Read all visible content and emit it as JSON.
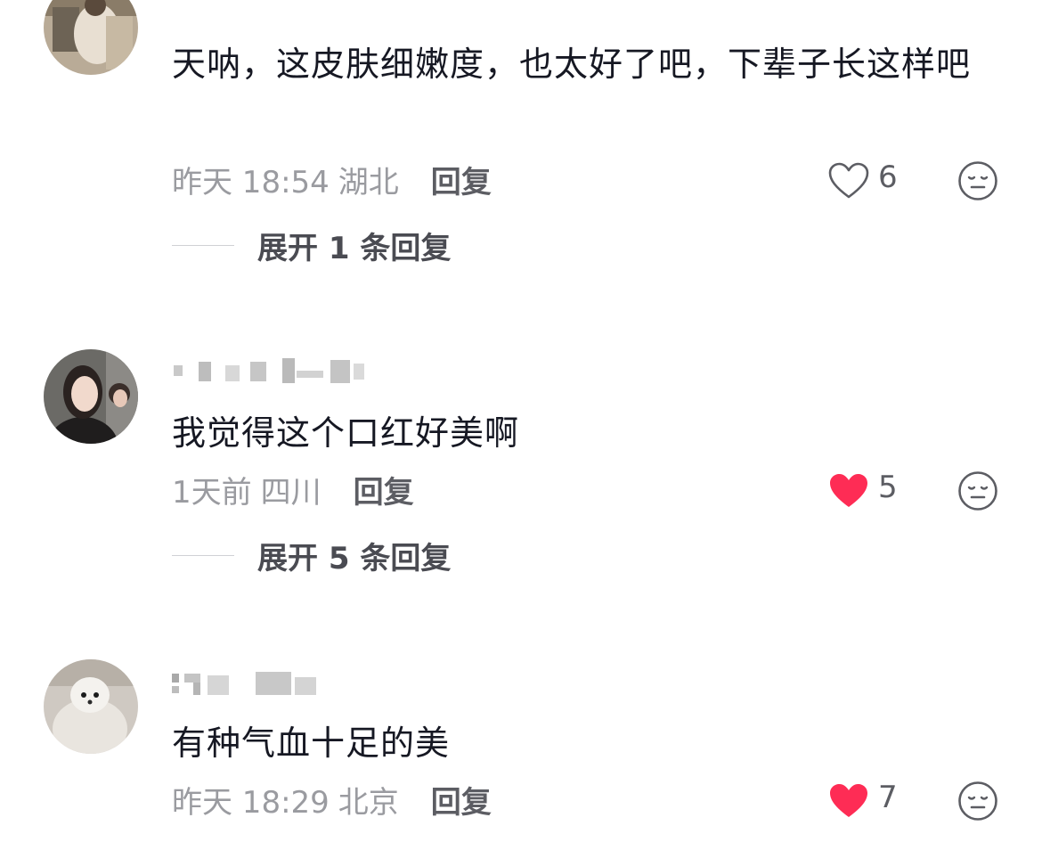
{
  "comments": [
    {
      "text": "天呐，这皮肤细嫩度，也太好了吧，下辈子长这样吧",
      "time": "昨天 18:54",
      "location": "湖北",
      "reply_label": "回复",
      "likes": "6",
      "liked": false,
      "expand_label": "展开 1 条回复",
      "avatar_icon": "avatar-photo-woman-seated"
    },
    {
      "text": "我觉得这个口红好美啊",
      "time": "1天前",
      "location": "四川",
      "reply_label": "回复",
      "likes": "5",
      "liked": true,
      "expand_label": "展开 5 条回复",
      "avatar_icon": "avatar-photo-woman-portrait"
    },
    {
      "text": "有种气血十足的美",
      "time": "昨天 18:29",
      "location": "北京",
      "reply_label": "回复",
      "likes": "7",
      "liked": true,
      "avatar_icon": "avatar-photo-white-dog"
    }
  ],
  "colors": {
    "liked_heart": "#fe2c55",
    "text_primary": "#161823",
    "text_secondary": "#9a9ba0"
  }
}
